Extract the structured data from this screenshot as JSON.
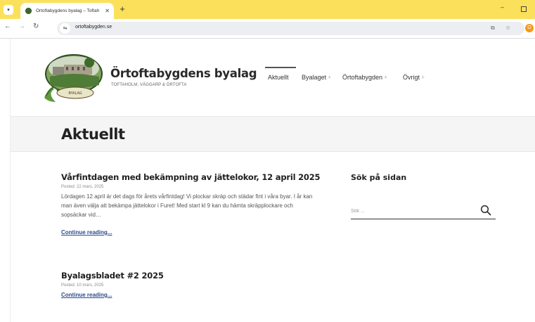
{
  "browser": {
    "tab_title": "Örtoftabygdens byalag – Toftah",
    "url": "ortoftabygden.se",
    "profile_initial": "O",
    "accent_color": "#fbe05c"
  },
  "site": {
    "title": "Örtoftabygdens byalag",
    "tagline": "TOFTAHOLM, VÄGGARP & ÖRTOFTA",
    "logo_banner_text": "BYALAG"
  },
  "nav": {
    "items": [
      {
        "label": "Aktuellt",
        "active": true,
        "has_submenu": false
      },
      {
        "label": "Byalaget",
        "has_submenu": true
      },
      {
        "label": "Örtoftabygden",
        "has_submenu": true
      },
      {
        "label": "Övrigt",
        "has_submenu": true
      }
    ],
    "submenu_symbol": "+"
  },
  "page": {
    "heading": "Aktuellt"
  },
  "posts": [
    {
      "title": "Vårfintdagen med bekämpning av jättelokor, 12 april 2025",
      "date": "Posted: 22 mars, 2025",
      "excerpt": "Lördagen 12 april är det dags för årets vårfintdag! Vi plockar skräp och städar fint i våra byar. I år kan man även välja att bekämpa jättelokor i Furet! Med start kl 9 kan du hämta skräpplockare och sopsäckar vid…",
      "continue_label": "Continue reading..."
    },
    {
      "title": "Byalagsbladet #2 2025",
      "date": "Posted: 10 mars, 2025",
      "excerpt": "",
      "continue_label": "Continue reading..."
    }
  ],
  "sidebar": {
    "search_title": "Sök på sidan",
    "search_placeholder": "Sök ..."
  }
}
